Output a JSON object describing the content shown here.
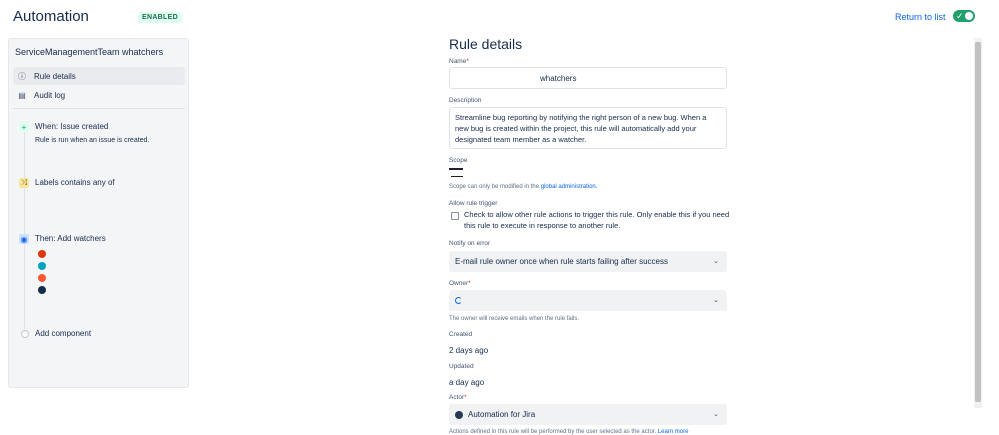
{
  "header": {
    "title": "Automation",
    "badge": "ENABLED",
    "return_link": "Return to list",
    "toggle_state": "on",
    "toggle_color": "#22a06b"
  },
  "sidebar": {
    "title": "ServiceManagementTeam whatchers",
    "nav": [
      {
        "label": "Rule details",
        "icon": "info-icon",
        "active": true
      },
      {
        "label": "Audit log",
        "icon": "document-icon",
        "active": false
      }
    ],
    "components": [
      {
        "title": "When: Issue created",
        "subtitle": "Rule is run when an issue is created.",
        "icon": "plus-icon"
      },
      {
        "title": "Labels contains any of",
        "subtitle": "",
        "icon": "shuffle-icon"
      },
      {
        "title": "Then: Add watchers",
        "subtitle": "",
        "icon": "eye-icon"
      }
    ],
    "add_component": "Add component",
    "avatar_colors": [
      "#de350b",
      "#00a3bf",
      "#ff5630",
      "#172b4d"
    ]
  },
  "main": {
    "title": "Rule details",
    "name_label": "Name",
    "name_value": "whatchers",
    "description_label": "Description",
    "description_value": "Streamline bug reporting by notifying the right person of a new bug. When a new bug is created within the project, this rule will automatically add your designated team member as a watcher.",
    "scope_label": "Scope",
    "scope_note_prefix": "Scope can only be modified in the",
    "scope_note_link": "global administration.",
    "allow_trigger_label": "Allow rule trigger",
    "allow_trigger_text": "Check to allow other rule actions to trigger this rule. Only enable this if you need this rule to execute in response to another rule.",
    "notify_label": "Notify on error",
    "notify_value": "E-mail rule owner once when rule starts failing after success",
    "owner_label": "Owner",
    "owner_note": "The owner will receive emails when the rule fails.",
    "created_label": "Created",
    "created_value": "2 days ago",
    "updated_label": "Updated",
    "updated_value": "a day ago",
    "actor_label": "Actor",
    "actor_value": "Automation for Jira",
    "actor_note": "Actions defined in this rule will be performed by the user selected as the actor.",
    "actor_note_link": "Learn more"
  }
}
